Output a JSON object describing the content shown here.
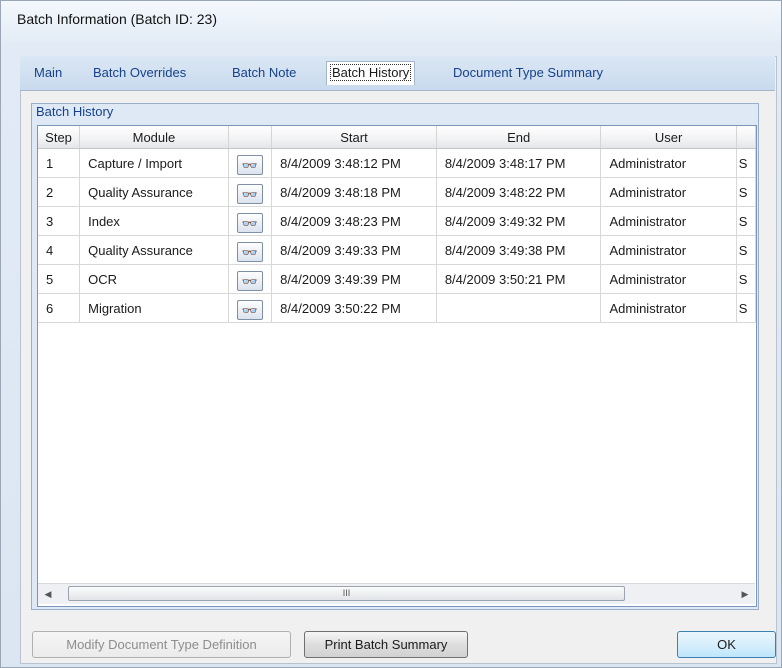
{
  "window": {
    "title": "Batch Information (Batch ID: 23)"
  },
  "tabs": [
    {
      "label": "Main"
    },
    {
      "label": "Batch Overrides"
    },
    {
      "label": "Batch Note"
    },
    {
      "label": "Batch History",
      "active": true
    },
    {
      "label": "Document Type Summary"
    }
  ],
  "group": {
    "title": "Batch History"
  },
  "grid": {
    "columns": [
      "Step",
      "Module",
      "",
      "Start",
      "End",
      "User"
    ],
    "rows": [
      {
        "step": "1",
        "module": "Capture / Import",
        "start": "8/4/2009 3:48:12 PM",
        "end": "8/4/2009 3:48:17 PM",
        "user": "Administrator"
      },
      {
        "step": "2",
        "module": "Quality Assurance",
        "start": "8/4/2009 3:48:18 PM",
        "end": "8/4/2009 3:48:22 PM",
        "user": "Administrator"
      },
      {
        "step": "3",
        "module": "Index",
        "start": "8/4/2009 3:48:23 PM",
        "end": "8/4/2009 3:49:32 PM",
        "user": "Administrator"
      },
      {
        "step": "4",
        "module": "Quality Assurance",
        "start": "8/4/2009 3:49:33 PM",
        "end": "8/4/2009 3:49:38 PM",
        "user": "Administrator"
      },
      {
        "step": "5",
        "module": "OCR",
        "start": "8/4/2009 3:49:39 PM",
        "end": "8/4/2009 3:50:21 PM",
        "user": "Administrator"
      },
      {
        "step": "6",
        "module": "Migration",
        "start": "8/4/2009 3:50:22 PM",
        "end": "",
        "user": "Administrator"
      }
    ],
    "row_icon": "binoculars-icon",
    "truncated_column_glyph": "S"
  },
  "scrollbar": {
    "left_glyph": "◀",
    "right_glyph": "▶",
    "thumb_grip": "III"
  },
  "buttons": {
    "modify": "Modify Document Type Definition",
    "print": "Print Batch Summary",
    "ok": "OK"
  },
  "colors": {
    "tab_text": "#15428b",
    "group_bg": "#dfe9f5",
    "accent": "#3c7fb1"
  }
}
